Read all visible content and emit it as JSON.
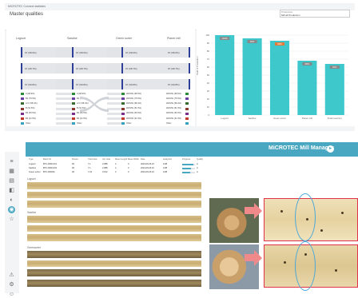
{
  "top_window": {
    "title": "MiCROTEC Connect statistics",
    "page_title": "Master qualities",
    "search": {
      "label": "Production",
      "value": "Mill all Production"
    }
  },
  "sankey": {
    "columns": [
      "Logsort",
      "Sawline",
      "Green sorter",
      "Planer mill"
    ],
    "left_nodes": [
      "97 (98.6%)",
      "97 (98.7%)",
      "97 (99.8%)"
    ],
    "mid_nodes": [
      "97 (98.6%)",
      "97 (98.7%)",
      "97 (99.8%)"
    ],
    "right_nodes": [
      "97 (98.6%)",
      "97 (98.7%)",
      "97 (99.8%)"
    ],
    "far_nodes": [
      "97 (98.6%)",
      "97 (98.7%)",
      "97 (99.8%)"
    ],
    "small_rows": [
      {
        "color": "#2e8b3a",
        "left": "A (68.9%)",
        "mid": "A (68.9%)",
        "right": "WASTE (68.9%)",
        "far": "WASTE (68.9%)"
      },
      {
        "color": "#6b3fa0",
        "left": "B1 (75.5%)",
        "mid": "B1 (75.5%)",
        "right": "WASTE (75.5%)",
        "far": "WASTE (75.5%)"
      },
      {
        "color": "#3a6b2e",
        "left": "A IV (58.4%)",
        "mid": "A IV (58.4%)",
        "right": "WASTE (58.4%)",
        "far": "WASTE (58.4%)"
      },
      {
        "color": "#8b3a2e",
        "left": "B (51.5%)",
        "mid": "B (51.5%)",
        "right": "WASTE (51.5%)",
        "far": "WASTE (51.5%)"
      },
      {
        "color": "#7a2e8b",
        "left": "B2 (50.5%)",
        "mid": "B2 (50.5%)",
        "right": "WASTE (50.5%)",
        "far": "WASTE (50.5%)"
      },
      {
        "color": "#c0392b",
        "left": "B4 (41.5%)",
        "mid": "B4 (41.5%)",
        "right": "WASTE (41.5%)",
        "far": "WASTE (41.5%)"
      },
      {
        "color": "#3aa0c0",
        "left": "Other",
        "mid": "Other",
        "right": "Other",
        "far": "Other"
      }
    ]
  },
  "chart_data": {
    "type": "bar",
    "ylabel": "Yield of Production",
    "categories": [
      "Logsort",
      "Sawline",
      "Green sorter",
      "Planer mill",
      "Final inventory"
    ],
    "values": [
      100,
      96,
      93,
      68,
      64
    ],
    "value_labels": [
      "100%",
      "96%",
      "93%",
      "68%",
      "64%"
    ],
    "label_colors": [
      "#888888",
      "#888888",
      "#e07b39",
      "#888888",
      "#888888"
    ],
    "bar_color": "#3ec8cc",
    "ylim": [
      0,
      100
    ],
    "yticks": [
      "100",
      "90",
      "80",
      "70",
      "60",
      "50",
      "40",
      "30",
      "20",
      "10",
      "0"
    ]
  },
  "bottom_window": {
    "brand": "MiCROTEC  Mill Manager",
    "sidebar_icons": [
      "list-icon",
      "grid-icon",
      "chart-icon",
      "tag-icon",
      "drop-icon",
      "target-icon",
      "star-icon",
      "alert-icon",
      "settings-icon",
      "user-icon"
    ],
    "table": {
      "headers": [
        "Type",
        "Batch ID",
        "Pieces",
        "Yield total",
        "Vol. total",
        "Mean Length",
        "Mean Width",
        "Date",
        "Analyzed",
        "Progress",
        "Quality"
      ],
      "rows": [
        [
          "Logsort",
          "BTC-0000-001",
          "96",
          "7.1",
          "2.988",
          "4",
          "0",
          "2024-06-06 10",
          "1/98",
          "85",
          "A"
        ],
        [
          "Sawline",
          "BTC-0000-002",
          "96",
          "7.1",
          "2.988",
          "4",
          "0",
          "2024-06-06 10",
          "1/98",
          "70",
          "A"
        ],
        [
          "Green sorter",
          "BTC-000001",
          "96",
          "7.22",
          "3.102",
          "3",
          "0",
          "2024-06-06 10",
          "1/98",
          "60",
          "A"
        ]
      ]
    },
    "sections": [
      "Logsort",
      "Sawline",
      "Greensorter"
    ],
    "accent": "#4aa7c1"
  }
}
